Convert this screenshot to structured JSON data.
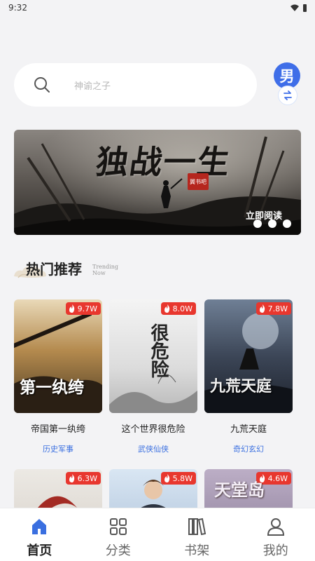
{
  "status_bar": {
    "time": "9:32"
  },
  "search": {
    "placeholder": "神谕之子"
  },
  "gender_toggle": {
    "label": "男"
  },
  "banner": {
    "title": "独战一生",
    "seal": "翼书吧",
    "cta": "立即阅读",
    "slide_count": 3
  },
  "section": {
    "title": "热门推荐",
    "subtitle": "Trending Now"
  },
  "books": [
    {
      "title": "帝国第一纨绔",
      "category": "历史军事",
      "heat": "9.7W",
      "cover_text": "第一纨绔"
    },
    {
      "title": "这个世界很危险",
      "category": "武侠仙侠",
      "heat": "8.0W",
      "cover_text": "很危险"
    },
    {
      "title": "九荒天庭",
      "category": "奇幻玄幻",
      "heat": "7.8W",
      "cover_text": "九荒天庭"
    },
    {
      "heat": "6.3W"
    },
    {
      "heat": "5.8W"
    },
    {
      "heat": "4.6W",
      "cover_text": "天堂岛"
    }
  ],
  "tabs": [
    {
      "label": "首页",
      "icon": "home-icon",
      "active": true
    },
    {
      "label": "分类",
      "icon": "grid-icon",
      "active": false
    },
    {
      "label": "书架",
      "icon": "bookshelf-icon",
      "active": false
    },
    {
      "label": "我的",
      "icon": "user-icon",
      "active": false
    }
  ],
  "colors": {
    "accent": "#3a6fe0",
    "heat": "#e8372e",
    "background": "#f3f3f5"
  }
}
